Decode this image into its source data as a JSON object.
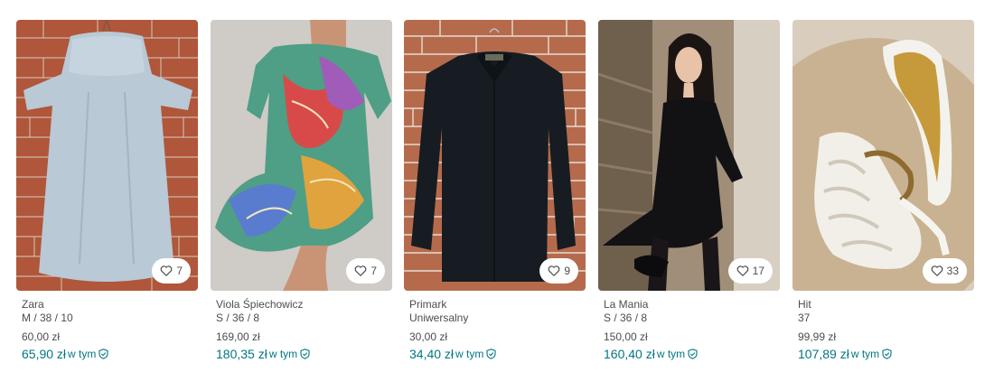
{
  "listings": [
    {
      "brand": "Zara",
      "size": "M / 38 / 10",
      "price": "60,00 zł",
      "total_price": "65,90 zł",
      "incl_label": "w tym",
      "favourites": "7",
      "heart_icon": "heart-outline-icon",
      "shield_icon": "shield-check-icon"
    },
    {
      "brand": "Viola Śpiechowicz",
      "size": "S / 36 / 8",
      "price": "169,00 zł",
      "total_price": "180,35 zł",
      "incl_label": "w tym",
      "favourites": "7",
      "heart_icon": "heart-outline-icon",
      "shield_icon": "shield-check-icon"
    },
    {
      "brand": "Primark",
      "size": "Uniwersalny",
      "price": "30,00 zł",
      "total_price": "34,40 zł",
      "incl_label": "w tym",
      "favourites": "9",
      "heart_icon": "heart-outline-icon",
      "shield_icon": "shield-check-icon"
    },
    {
      "brand": "La Mania",
      "size": "S / 36 / 8",
      "price": "150,00 zł",
      "total_price": "160,40 zł",
      "incl_label": "w tym",
      "favourites": "17",
      "heart_icon": "heart-outline-icon",
      "shield_icon": "shield-check-icon"
    },
    {
      "brand": "Hit",
      "size": "37",
      "price": "99,99 zł",
      "total_price": "107,89 zł",
      "incl_label": "w tym",
      "favourites": "33",
      "heart_icon": "heart-outline-icon",
      "shield_icon": "shield-check-icon"
    }
  ],
  "colors": {
    "accent": "#007782",
    "text_secondary": "#4d4d4d"
  }
}
